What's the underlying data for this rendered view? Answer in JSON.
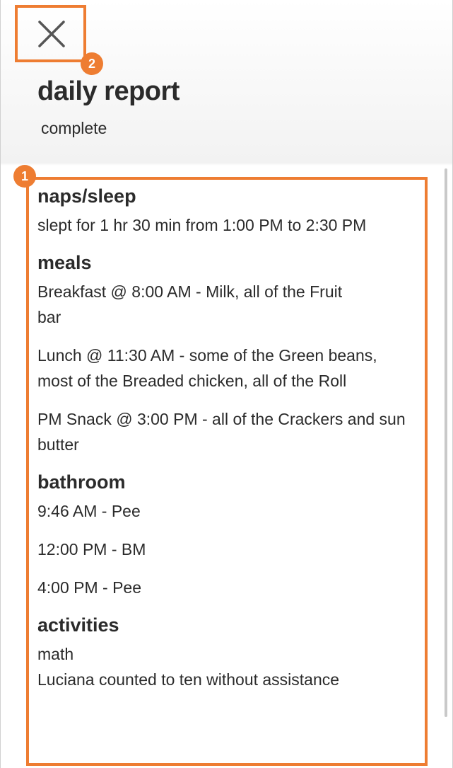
{
  "header": {
    "title": "daily report",
    "status": "complete",
    "close_icon": "close-icon"
  },
  "annotations": {
    "content_badge": "1",
    "close_badge": "2",
    "highlight_color": "#ee7d32"
  },
  "report": {
    "sections": [
      {
        "title": "naps/sleep",
        "entries": [
          "slept for 1 hr 30 min from 1:00 PM to 2:30 PM"
        ]
      },
      {
        "title": "meals",
        "entries": [
          "Breakfast @ 8:00 AM - Milk, all of the Fruit bar",
          "Lunch @ 11:30 AM - some of the Green beans, most of the Breaded chicken, all of the Roll",
          "PM Snack @ 3:00 PM - all of the Crackers and sun butter"
        ]
      },
      {
        "title": "bathroom",
        "entries": [
          "9:46 AM - Pee",
          "12:00 PM - BM",
          "4:00 PM - Pee"
        ]
      },
      {
        "title": "activities",
        "entries": [
          "math",
          "Luciana counted to ten without assistance"
        ]
      }
    ]
  }
}
